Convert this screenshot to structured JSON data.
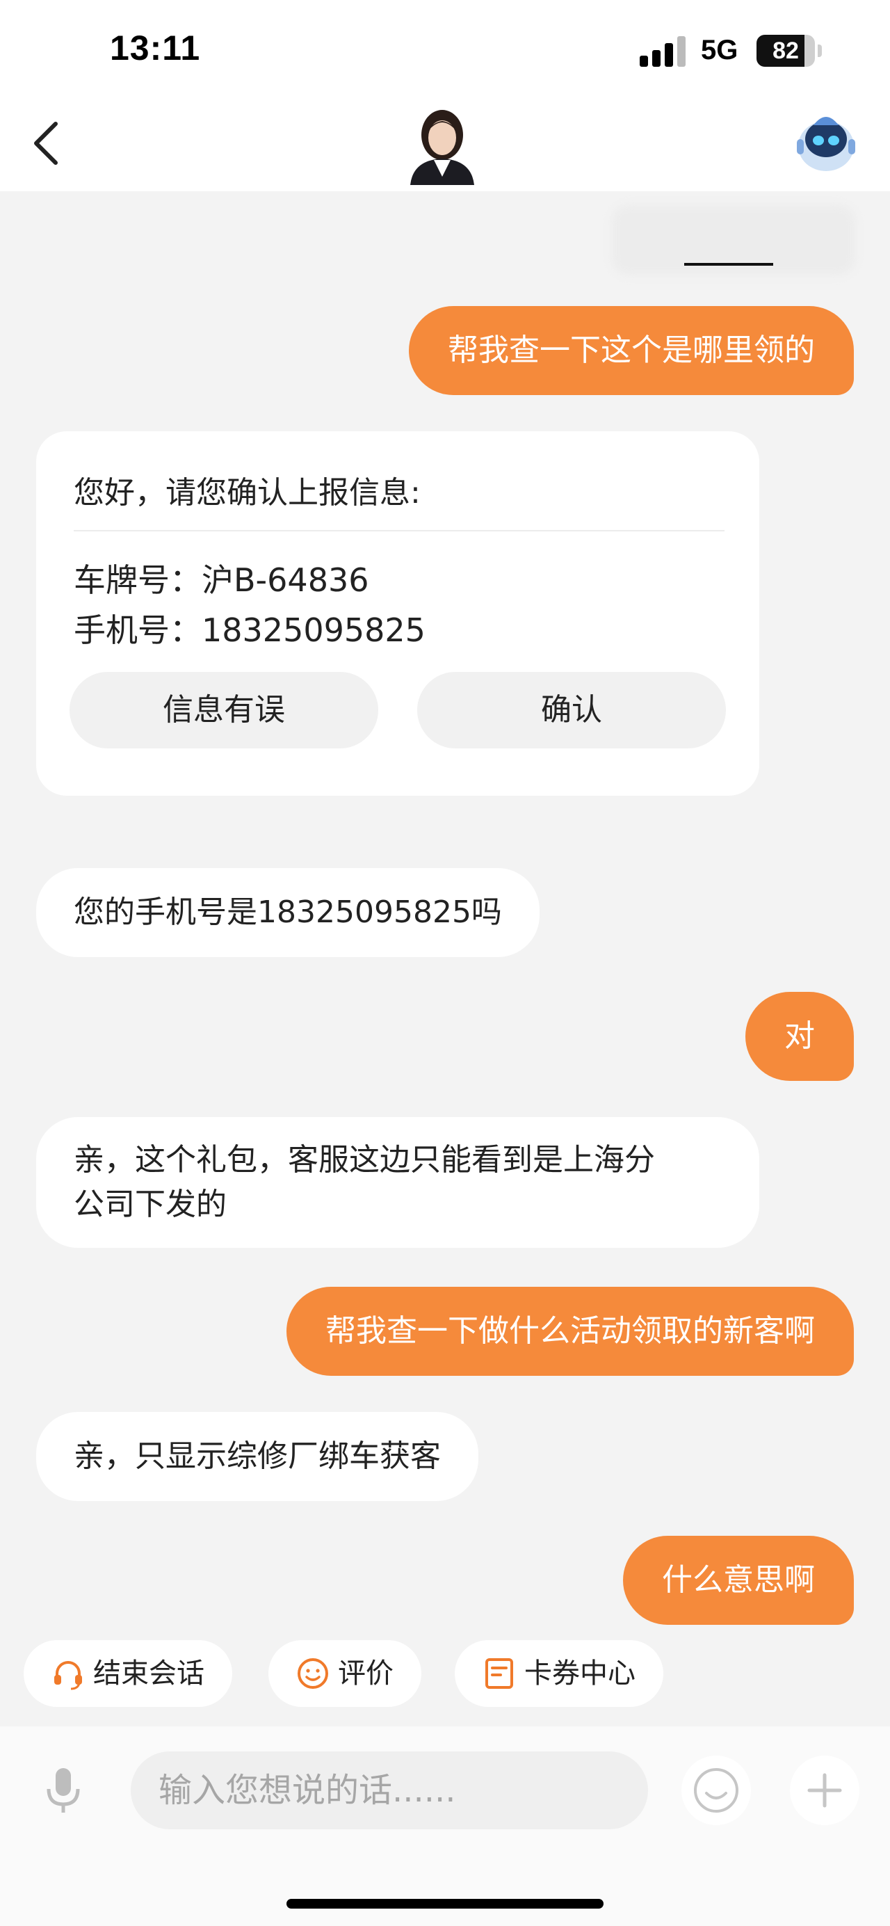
{
  "status_bar": {
    "time": "13:11",
    "network": "5G",
    "battery": "82",
    "battery_level": 0.82
  },
  "nav": {
    "back_icon": "chevron-left-icon",
    "avatar": "agent-avatar",
    "bot_icon": "robot-icon"
  },
  "messages": [
    {
      "from": "user",
      "text": "帮我查一下这个是哪里领的"
    },
    {
      "from": "bot",
      "type": "confirm-card",
      "title": "您好，请您确认上报信息:",
      "lines": [
        "车牌号：沪B-64836",
        "手机号：18325095825"
      ],
      "buttons": [
        "信息有误",
        "确认"
      ]
    },
    {
      "from": "bot",
      "text": "您的手机号是18325095825吗"
    },
    {
      "from": "user",
      "text": "对"
    },
    {
      "from": "bot",
      "text_line1": "亲，这个礼包，客服这边只能看到是上海分",
      "text_line2": "公司下发的"
    },
    {
      "from": "user",
      "text": "帮我查一下做什么活动领取的新客啊"
    },
    {
      "from": "bot",
      "text": "亲，只显示综修厂绑车获客"
    },
    {
      "from": "user",
      "text": "什么意思啊"
    }
  ],
  "quick_actions": [
    {
      "label": "结束会话",
      "icon": "headset-icon"
    },
    {
      "label": "评价",
      "icon": "smiley-icon"
    },
    {
      "label": "卡券中心",
      "icon": "coupon-doc-icon"
    }
  ],
  "input": {
    "placeholder": "输入您想说的话......",
    "mic_icon": "microphone-icon",
    "emoji_icon": "emoji-icon",
    "plus_icon": "plus-icon"
  },
  "colors": {
    "accent": "#f58a3b",
    "background": "#f3f3f3",
    "bubble_bot": "#ffffff"
  }
}
